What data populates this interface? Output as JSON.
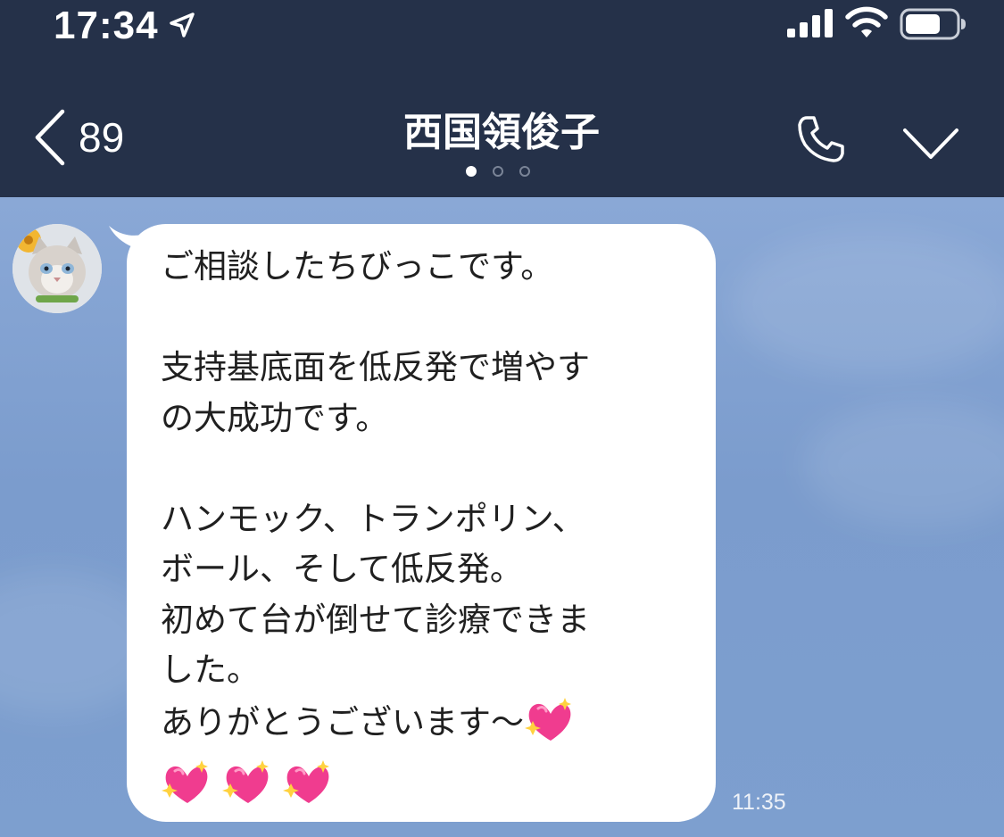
{
  "status_bar": {
    "time": "17:34",
    "location_icon": "location-arrow-icon",
    "signal_icon": "cellular-signal-icon",
    "wifi_icon": "wifi-icon",
    "battery_icon": "battery-icon"
  },
  "header": {
    "back_icon": "chevron-left-icon",
    "back_count": "89",
    "title": "西国領俊子",
    "page_dots": 3,
    "active_dot": 0,
    "call_icon": "phone-icon",
    "menu_icon": "chevron-down-icon",
    "background_color": "#253149"
  },
  "chat": {
    "background_color": "#7a9ccf",
    "message": {
      "sender_avatar": "cat-avatar",
      "lines_before_hearts": "ご相談したちびっこです。\n\n支持基底面を低反発で増やす\nの大成功です。\n\nハンモック、トランポリン、\nボール、そして低反発。\n初めて台が倒せて診療できま\nした。\nありがとうございます～",
      "emoji": "💖",
      "emoji_count": 4,
      "time": "11:35"
    }
  }
}
